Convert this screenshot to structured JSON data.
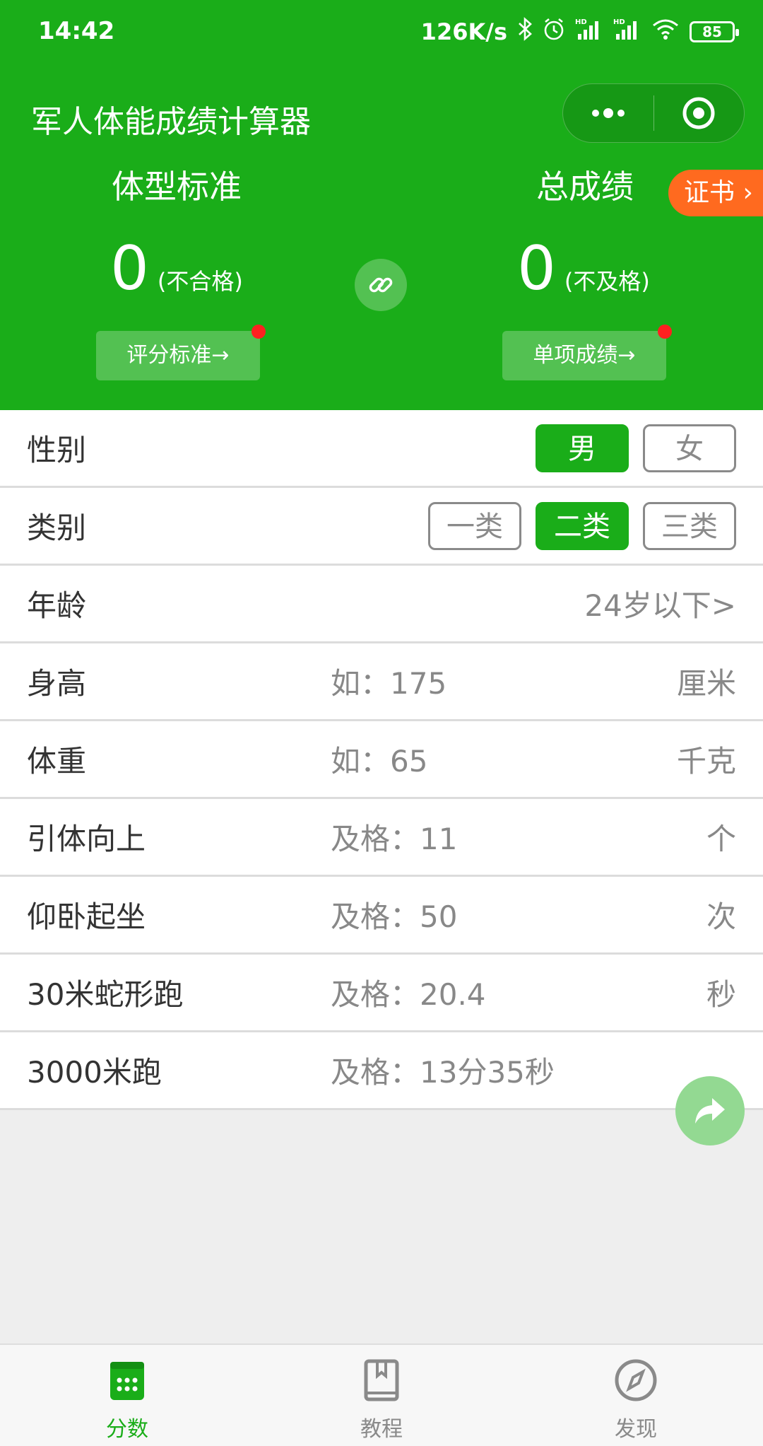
{
  "status_bar": {
    "time": "14:42",
    "net_speed": "126K/s",
    "battery": "85",
    "icons": [
      "bluetooth-icon",
      "alarm-icon",
      "signal-hd-icon",
      "signal-hd-icon",
      "wifi-icon",
      "battery-icon"
    ]
  },
  "header": {
    "app_title": "军人体能成绩计算器",
    "left": {
      "title": "体型标准",
      "score": "0",
      "note": "(不合格)",
      "button": "评分标准→"
    },
    "right": {
      "title": "总成绩",
      "score": "0",
      "note": "(不及格)",
      "button": "单项成绩→"
    },
    "certificate": "证书",
    "colors": {
      "primary": "#1aad19",
      "badge": "#ff6a1f",
      "dot": "#ff2020"
    }
  },
  "form": {
    "gender": {
      "label": "性别",
      "options": [
        "男",
        "女"
      ],
      "selected": "男"
    },
    "category": {
      "label": "类别",
      "options": [
        "一类",
        "二类",
        "三类"
      ],
      "selected": "二类"
    },
    "age": {
      "label": "年龄",
      "value": "24岁以下>"
    },
    "height": {
      "label": "身高",
      "placeholder": "如：175",
      "unit": "厘米"
    },
    "weight": {
      "label": "体重",
      "placeholder": "如：65",
      "unit": "千克"
    },
    "pullup": {
      "label": "引体向上",
      "placeholder": "及格：11",
      "unit": "个"
    },
    "situp": {
      "label": "仰卧起坐",
      "placeholder": "及格：50",
      "unit": "次"
    },
    "snake_run": {
      "label": "30米蛇形跑",
      "placeholder": "及格：20.4",
      "unit": "秒"
    },
    "run3000": {
      "label": "3000米跑",
      "placeholder": "及格：13分35秒"
    }
  },
  "tabbar": {
    "tabs": [
      {
        "label": "分数",
        "icon": "calendar-icon",
        "active": true
      },
      {
        "label": "教程",
        "icon": "book-icon",
        "active": false
      },
      {
        "label": "发现",
        "icon": "compass-icon",
        "active": false
      }
    ]
  }
}
